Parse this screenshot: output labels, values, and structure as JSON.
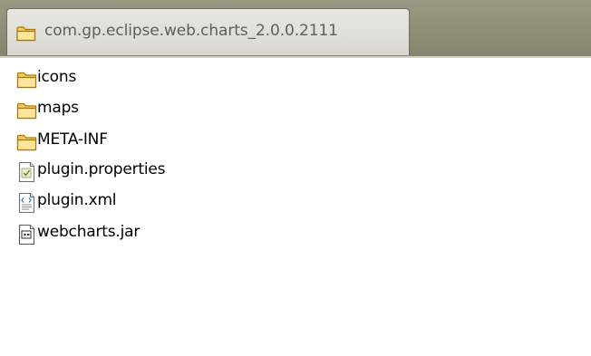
{
  "window": {
    "title": "com.gp.eclipse.web.charts_2.0.0.2111",
    "title_icon": "folder-icon"
  },
  "files": [
    {
      "name": "icons",
      "type": "folder",
      "icon": "folder-icon"
    },
    {
      "name": "maps",
      "type": "folder",
      "icon": "folder-icon"
    },
    {
      "name": "META-INF",
      "type": "folder",
      "icon": "folder-icon"
    },
    {
      "name": "plugin.properties",
      "type": "file",
      "icon": "properties-file-icon"
    },
    {
      "name": "plugin.xml",
      "type": "file",
      "icon": "xml-file-icon"
    },
    {
      "name": "webcharts.jar",
      "type": "file",
      "icon": "jar-file-icon"
    }
  ],
  "colors": {
    "title_bar": "#8f8f78",
    "tab_background": "#dedcd6",
    "folder_fill": "#f5cf6a",
    "folder_outline": "#b88a12"
  }
}
